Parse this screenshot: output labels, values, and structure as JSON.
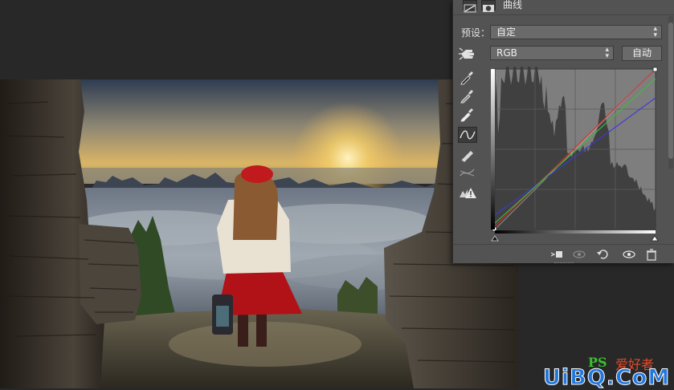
{
  "panel": {
    "title": "曲线",
    "preset_label": "预设：",
    "preset_value": "自定",
    "channel_value": "RGB",
    "auto_label": "自动"
  },
  "graph": {
    "grid_divisions": 4,
    "colors": {
      "composite": "#c8c8c8",
      "red": "#d23232",
      "green": "#3cbe3c",
      "blue": "#3a3ad8",
      "histogram": "#3a3a3a",
      "graph_bg": "#7e7e7e"
    }
  },
  "tools": [
    "sample-in-image-icon",
    "black-point-eyedropper-icon",
    "gray-point-eyedropper-icon",
    "white-point-eyedropper-icon",
    "curve-points-icon",
    "pencil-draw-icon",
    "smooth-curve-icon",
    "clipping-warning-icon"
  ],
  "footer_icons": [
    "clip-to-layer-icon",
    "view-previous-icon",
    "reset-icon",
    "visibility-eye-icon",
    "delete-trash-icon"
  ],
  "watermark": {
    "brand": "UiBQ.CoM",
    "ps_text": "PS",
    "cn_text": "爱好者"
  },
  "colors": {
    "app_bg": "#282828",
    "panel_bg": "#535353",
    "control_bg": "#6a6a6a"
  }
}
